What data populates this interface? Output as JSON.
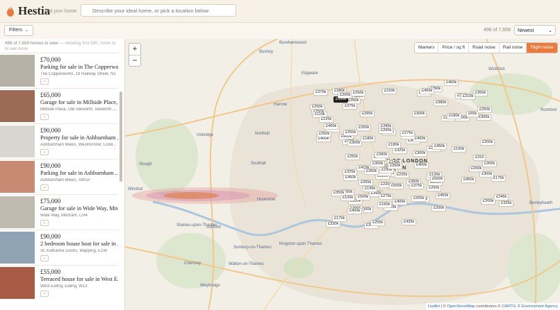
{
  "header": {
    "brand": "Hestia",
    "tagline": "find your home",
    "search_placeholder": "Describe your ideal home, or pick a location below"
  },
  "toolbar": {
    "filters_label": "Filters",
    "result_count": "496 of 7,659",
    "sort_value": "Newest"
  },
  "sidebar": {
    "summary_count": "496 of 7,659 homes in view",
    "summary_note": "— showing first 500, zoom in to see more",
    "listings": [
      {
        "price": "£70,000",
        "title": "Parking for sale in The Copperworks...",
        "address": "The Copperworks, 19 Railway Street, N1"
      },
      {
        "price": "£65,000",
        "title": "Garage for sale in Millside Place, ...",
        "address": "Millside Place, Old Isleworth, Isleworth, ..."
      },
      {
        "price": "£90,000",
        "title": "Property for sale in Ashburnham ...",
        "address": "Ashburnham Mews, Westminster, Lond..."
      },
      {
        "price": "£90,000",
        "title": "Parking for sale in Ashburnham ...",
        "address": "Ashburnham Mews, SW1P"
      },
      {
        "price": "£75,000",
        "title": "Garage for sale in Wide Way, Mitc...",
        "address": "Wide Way, Mitcham, CR4"
      },
      {
        "price": "£90,000",
        "title": "2 bedroom house boat for sale in ...",
        "address": "St. Katharine Docks, Wapping, E1W"
      },
      {
        "price": "£55,000",
        "title": "Terraced house for sale in West E...",
        "address": "West Ealing, Ealing, W13"
      }
    ]
  },
  "map": {
    "layers": [
      "Markers",
      "Price / sq ft",
      "Road noise",
      "Rail noise",
      "Flight noise"
    ],
    "active_layer": "Flight noise",
    "zoom_in": "+",
    "zoom_out": "−",
    "attribution": {
      "leaflet": "Leaflet",
      "osm": "OpenStreetMap",
      "carto": "CARTO",
      "ea": "Environment Agency",
      "sep": "|",
      "c1": "© ",
      "c2": " contributors © ",
      "c3": ", © "
    },
    "places": [
      {
        "name": "Borehamwood",
        "id": "borehamwood"
      },
      {
        "name": "Bushey",
        "id": "bushey"
      },
      {
        "name": "Edgware",
        "id": "edgware"
      },
      {
        "name": "Harrow",
        "id": "harrow"
      },
      {
        "name": "Northolt",
        "id": "northolt"
      },
      {
        "name": "Uxbridge",
        "id": "uxbridge"
      },
      {
        "name": "Southall",
        "id": "southall"
      },
      {
        "name": "Slough",
        "id": "slough"
      },
      {
        "name": "Windsor",
        "id": "windsor"
      },
      {
        "name": "Hounslow",
        "id": "hounslow"
      },
      {
        "name": "Staines-upon-Thames",
        "id": "staines"
      },
      {
        "name": "Ashford",
        "id": "ashford"
      },
      {
        "name": "Sunbury-on-Thames",
        "id": "sunbury"
      },
      {
        "name": "Kingston upon Thames",
        "id": "kingston"
      },
      {
        "name": "Chertsey",
        "id": "chertsey"
      },
      {
        "name": "Walton-on-Thames",
        "id": "walton"
      },
      {
        "name": "Weybridge",
        "id": "weybridge"
      },
      {
        "name": "Wickford",
        "id": "wickford"
      },
      {
        "name": "Romford",
        "id": "romford"
      },
      {
        "name": "Bexleyheath",
        "id": "bexleyheath"
      },
      {
        "name": "CITY OF LONDON",
        "id": "city"
      },
      {
        "name": "LONDON",
        "id": "london"
      }
    ],
    "markers": [
      "£286",
      "£245k",
      "£18",
      "£365k",
      "£300k",
      "£300k",
      "£250k",
      "£200k",
      "£400k",
      "£425k",
      "£290k",
      "£200k",
      "£350k",
      "£380k",
      "£350k",
      "£500k",
      "£400k",
      "£425k",
      "£370k",
      "£350k",
      "£450k",
      "£400k",
      "£375k",
      "£400k",
      "£365k",
      "£325k",
      "£400k",
      "£425k",
      "£220k",
      "£225k",
      "£180k",
      "£350k",
      "£345k",
      "£400k",
      "£200k",
      "£375k",
      "£350k",
      "£350k",
      "£325k",
      "£400k",
      "£250k",
      "£250k",
      "£395k",
      "£200k",
      "£110k",
      "£140k",
      "£400k",
      "£450k",
      "£35k",
      "£300k",
      "£300k",
      "£450k",
      "£420k",
      "£345k",
      "£250k",
      "£400k",
      "£180k",
      "£500k",
      "£365k",
      "£200k",
      "£400k",
      "£295k",
      "£65k",
      "£250k",
      "£240k",
      "£300k",
      "£450k",
      "£280k",
      "£310",
      "£265k",
      "£300k",
      "£255k",
      "£170k",
      "£126k",
      "£415k",
      "£230k",
      "£250k",
      "£270k",
      "£320k",
      "£200k",
      "£200k",
      "£325k",
      "£195k",
      "£245k",
      "£435k",
      "£175k",
      "£180k",
      "£160k",
      "£390k",
      "£500k",
      "£210k",
      "£250k",
      "£300k",
      "£225k",
      "£275k",
      "£180k",
      "£200k",
      "£160k",
      "£250k",
      "£500k",
      "£400k",
      "£250k",
      "£450k",
      "£250k",
      "£225k",
      "£350k",
      "£400k",
      "£450k",
      "£350k",
      "£375k",
      "£300k",
      "£200k",
      "£100k",
      "£245k",
      "£150k",
      "£275k"
    ]
  },
  "colors": {
    "accent": "#ea7b3d",
    "background": "#faf6ef",
    "map": "#f2efe6"
  }
}
